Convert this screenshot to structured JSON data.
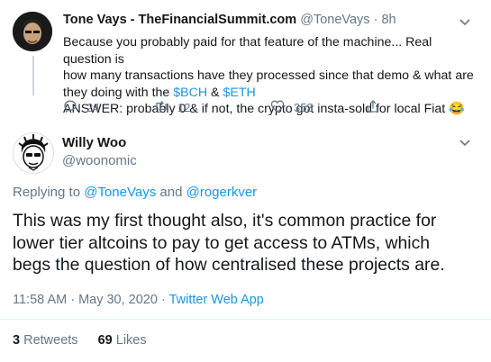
{
  "parent_tweet": {
    "author_name": "Tone Vays - TheFinancialSummit.com",
    "handle": "@ToneVays",
    "separator": "·",
    "time": "8h",
    "text_line1": "Because you probably paid for that feature of the machine... Real question is",
    "text_line2": "how many transactions have they processed since that demo & what are",
    "text_line3_prefix": "they doing with the ",
    "cashtag_bch": "$BCH",
    "amp": " & ",
    "cashtag_eth": "$ETH",
    "text_line4": "ANSWER: probably 0 & if not, the crypto got insta-sold for local Fiat ",
    "emoji": "😂",
    "replies": "24",
    "retweets": "12",
    "likes": "353"
  },
  "main_tweet": {
    "author_name": "Willy Woo",
    "handle": "@woonomic",
    "replying_prefix": "Replying to ",
    "reply_to_1": "@ToneVays",
    "reply_and": " and ",
    "reply_to_2": "@rogerkver",
    "text_line1": "This was my first thought also, it's common practice for",
    "text_line2": "lower tier altcoins to pay to get access to ATMs, which",
    "text_line3": "begs the question of how centralised these projects are.",
    "timestamp": "11:58 AM · May 30, 2020",
    "meta_separator": " · ",
    "client": "Twitter Web App",
    "retweet_count": "3",
    "retweet_label": " Retweets",
    "like_count": "69",
    "like_label": " Likes"
  },
  "colors": {
    "accent": "#1b95e0",
    "muted": "#657786",
    "text": "#14171a",
    "divider": "#e6ecf0"
  },
  "icons": [
    "chevron-down-icon",
    "reply-icon",
    "retweet-icon",
    "like-icon",
    "share-icon"
  ]
}
